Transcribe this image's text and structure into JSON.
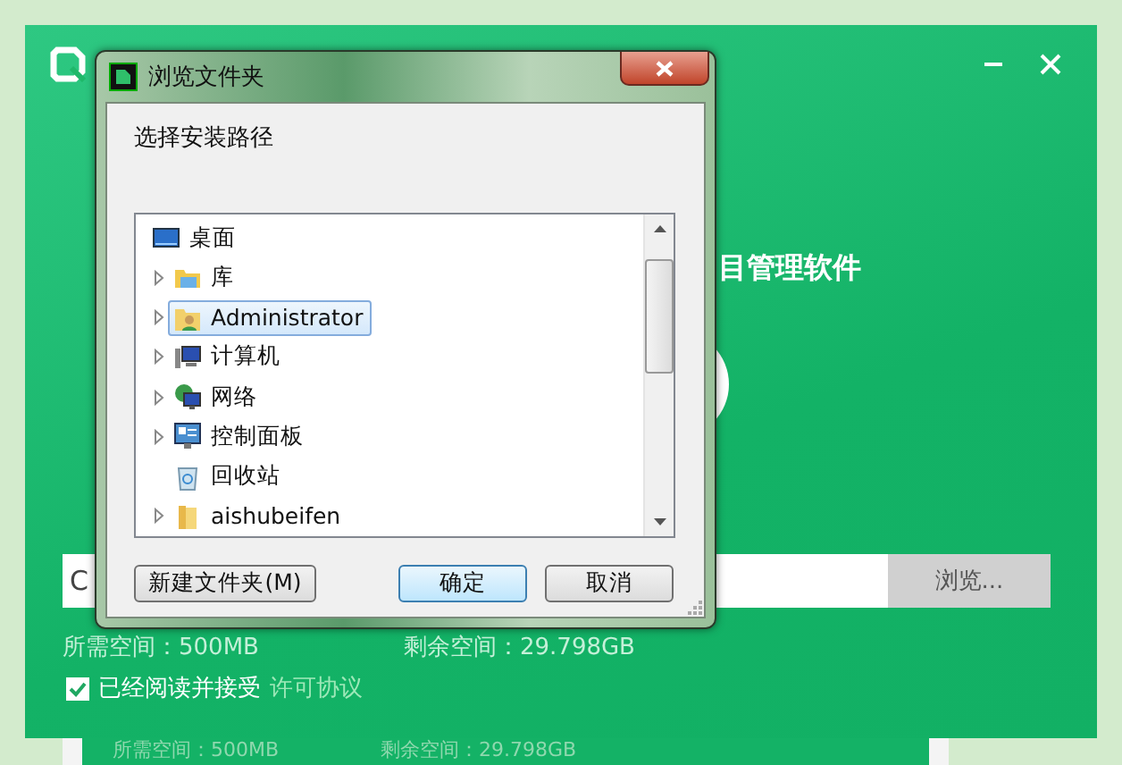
{
  "installer": {
    "heading": "目管理软件",
    "path_field": {
      "value": "C"
    },
    "browse_button": "浏览...",
    "required_space": "所需空间：500MB",
    "free_space": "剩余空间：29.798GB",
    "agreement": {
      "checked": true,
      "text": "已经阅读并接受",
      "link": "许可协议"
    }
  },
  "background_panel": {
    "required_space": "所需空间：500MB",
    "free_space": "剩余空间：29.798GB"
  },
  "dialog": {
    "title": "浏览文件夹",
    "prompt": "选择安装路径",
    "tree": [
      {
        "label": "桌面",
        "kind": "desktop",
        "expandable": false,
        "selected": false
      },
      {
        "label": "库",
        "kind": "library",
        "expandable": true,
        "selected": false
      },
      {
        "label": "Administrator",
        "kind": "user",
        "expandable": true,
        "selected": true
      },
      {
        "label": "计算机",
        "kind": "computer",
        "expandable": true,
        "selected": false
      },
      {
        "label": "网络",
        "kind": "network",
        "expandable": true,
        "selected": false
      },
      {
        "label": "控制面板",
        "kind": "control",
        "expandable": true,
        "selected": false
      },
      {
        "label": "回收站",
        "kind": "recycle",
        "expandable": false,
        "selected": false
      },
      {
        "label": "aishubeifen",
        "kind": "folder",
        "expandable": true,
        "selected": false
      }
    ],
    "buttons": [
      {
        "label": "新建文件夹(M)",
        "default": false
      },
      {
        "label": "确定",
        "default": true
      },
      {
        "label": "取消",
        "default": false
      }
    ]
  }
}
